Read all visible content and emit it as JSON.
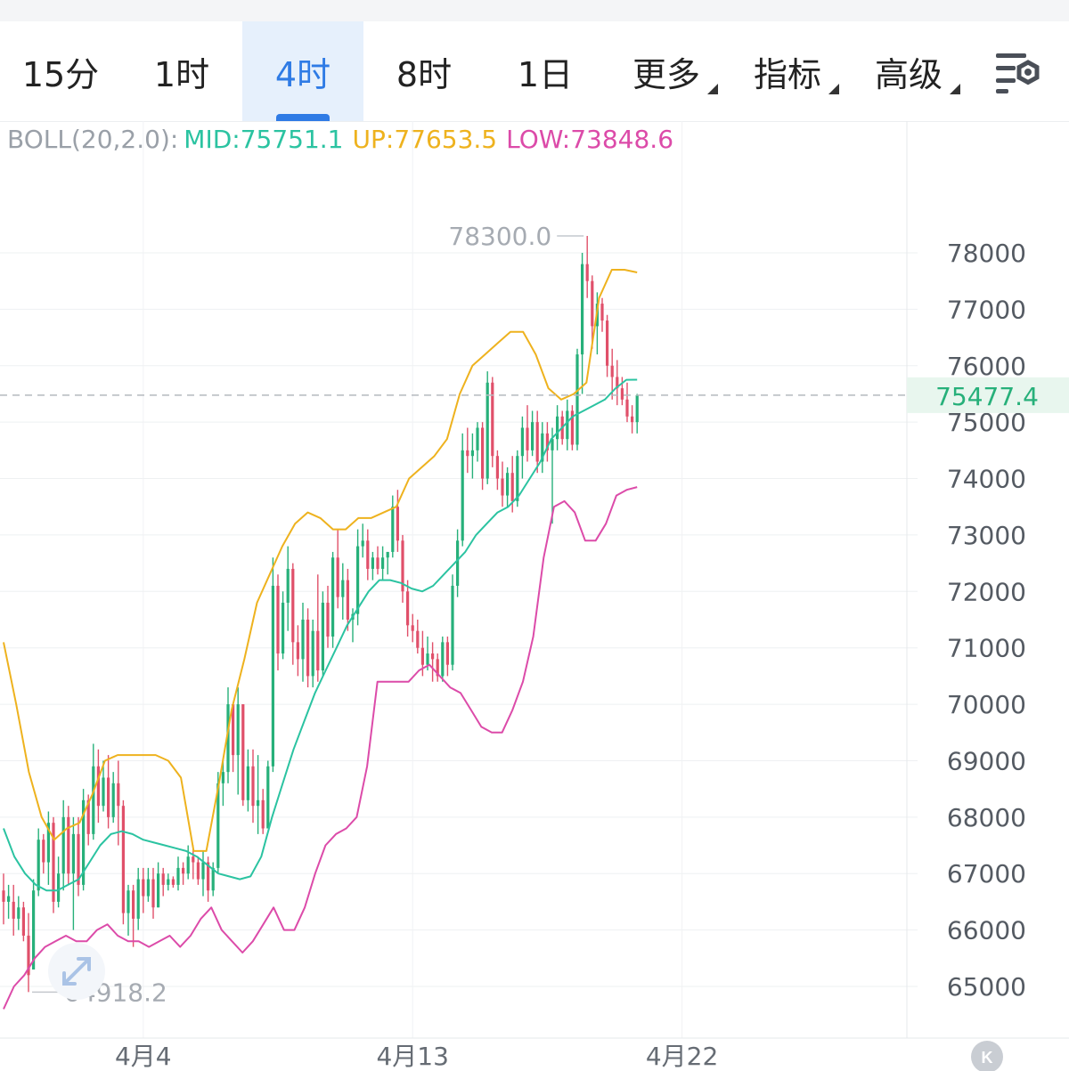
{
  "tabs": [
    {
      "label": "15分",
      "active": false,
      "dropdown": false
    },
    {
      "label": "1时",
      "active": false,
      "dropdown": false
    },
    {
      "label": "4时",
      "active": true,
      "dropdown": false
    },
    {
      "label": "8时",
      "active": false,
      "dropdown": false
    },
    {
      "label": "1日",
      "active": false,
      "dropdown": false
    },
    {
      "label": "更多",
      "active": false,
      "dropdown": true
    },
    {
      "label": "指标",
      "active": false,
      "dropdown": true
    },
    {
      "label": "高级",
      "active": false,
      "dropdown": true
    }
  ],
  "settings_icon": "chart-settings-icon",
  "boll": {
    "name": "BOLL(20,2.0):",
    "mid": "MID:75751.1",
    "up": "UP:77653.5",
    "low": "LOW:73848.6"
  },
  "colors": {
    "up_candle": "#27b07a",
    "down_candle": "#e0506a",
    "mid": "#2bc3a1",
    "upper": "#eeb21e",
    "lower": "#dc4ba9",
    "accent": "#2f7be5",
    "current_price_bg": "#e8f6ee",
    "current_price_text": "#27b07a"
  },
  "chart_data": {
    "type": "candlestick",
    "symbol_timeframe": "4时",
    "y_ticks": [
      65000,
      66000,
      67000,
      68000,
      69000,
      70000,
      71000,
      72000,
      73000,
      74000,
      75000,
      76000,
      77000,
      78000
    ],
    "ylim": [
      64300,
      79000
    ],
    "x_ticks": [
      {
        "index": 28,
        "label": "4月4"
      },
      {
        "index": 82,
        "label": "4月13"
      },
      {
        "index": 136,
        "label": "4月22"
      }
    ],
    "x_count": 152,
    "max_label": "78300.0",
    "min_label": "64918.2",
    "current_price": "75477.4",
    "current_price_value": 75477.4,
    "candles": [
      {
        "o": 66700,
        "h": 67000,
        "l": 66100,
        "c": 66500
      },
      {
        "o": 66500,
        "h": 66800,
        "l": 66200,
        "c": 66600
      },
      {
        "o": 66500,
        "h": 66800,
        "l": 65900,
        "c": 66200
      },
      {
        "o": 66200,
        "h": 66600,
        "l": 66000,
        "c": 66400
      },
      {
        "o": 66400,
        "h": 66500,
        "l": 65800,
        "c": 65900
      },
      {
        "o": 65900,
        "h": 66300,
        "l": 64900,
        "c": 65200
      },
      {
        "o": 65300,
        "h": 66900,
        "l": 65300,
        "c": 66700
      },
      {
        "o": 66700,
        "h": 67800,
        "l": 66600,
        "c": 67600
      },
      {
        "o": 67600,
        "h": 67700,
        "l": 67000,
        "c": 67200
      },
      {
        "o": 67200,
        "h": 68100,
        "l": 66800,
        "c": 67900
      },
      {
        "o": 67900,
        "h": 68000,
        "l": 66300,
        "c": 66500
      },
      {
        "o": 66500,
        "h": 67300,
        "l": 66400,
        "c": 67000
      },
      {
        "o": 67000,
        "h": 68300,
        "l": 66700,
        "c": 68000
      },
      {
        "o": 68000,
        "h": 68200,
        "l": 66800,
        "c": 67000
      },
      {
        "o": 67000,
        "h": 68000,
        "l": 66000,
        "c": 67700
      },
      {
        "o": 67700,
        "h": 68000,
        "l": 66600,
        "c": 66800
      },
      {
        "o": 66800,
        "h": 68500,
        "l": 66700,
        "c": 68300
      },
      {
        "o": 68300,
        "h": 68400,
        "l": 67500,
        "c": 67700
      },
      {
        "o": 67700,
        "h": 69300,
        "l": 67600,
        "c": 68900
      },
      {
        "o": 68900,
        "h": 69200,
        "l": 67900,
        "c": 68200
      },
      {
        "o": 68200,
        "h": 69000,
        "l": 68100,
        "c": 68700
      },
      {
        "o": 68700,
        "h": 69100,
        "l": 67800,
        "c": 68000
      },
      {
        "o": 68000,
        "h": 68800,
        "l": 67900,
        "c": 68600
      },
      {
        "o": 68600,
        "h": 69000,
        "l": 67500,
        "c": 68200
      },
      {
        "o": 68200,
        "h": 68300,
        "l": 66100,
        "c": 66300
      },
      {
        "o": 66300,
        "h": 66800,
        "l": 65900,
        "c": 66700
      },
      {
        "o": 66700,
        "h": 66800,
        "l": 65700,
        "c": 66200
      },
      {
        "o": 66200,
        "h": 67100,
        "l": 66000,
        "c": 66900
      },
      {
        "o": 66900,
        "h": 67100,
        "l": 66300,
        "c": 66600
      },
      {
        "o": 66600,
        "h": 67100,
        "l": 66500,
        "c": 66900
      },
      {
        "o": 66900,
        "h": 67100,
        "l": 66200,
        "c": 66400
      },
      {
        "o": 66400,
        "h": 67200,
        "l": 66400,
        "c": 67000
      },
      {
        "o": 67000,
        "h": 67100,
        "l": 66600,
        "c": 66800
      },
      {
        "o": 66800,
        "h": 67000,
        "l": 66700,
        "c": 66900
      },
      {
        "o": 66900,
        "h": 66950,
        "l": 66750,
        "c": 66800
      },
      {
        "o": 66800,
        "h": 67300,
        "l": 66700,
        "c": 67100
      },
      {
        "o": 67100,
        "h": 67200,
        "l": 66800,
        "c": 67000
      },
      {
        "o": 67000,
        "h": 67500,
        "l": 66900,
        "c": 67300
      },
      {
        "o": 67300,
        "h": 67500,
        "l": 66900,
        "c": 67200
      },
      {
        "o": 67200,
        "h": 67300,
        "l": 66800,
        "c": 66900
      },
      {
        "o": 66900,
        "h": 67400,
        "l": 66600,
        "c": 67200
      },
      {
        "o": 67200,
        "h": 67300,
        "l": 66500,
        "c": 66700
      },
      {
        "o": 66700,
        "h": 67200,
        "l": 66600,
        "c": 67100
      },
      {
        "o": 67100,
        "h": 68800,
        "l": 67000,
        "c": 68600
      },
      {
        "o": 68600,
        "h": 69000,
        "l": 68200,
        "c": 68800
      },
      {
        "o": 68800,
        "h": 70300,
        "l": 68600,
        "c": 70000
      },
      {
        "o": 70000,
        "h": 70000,
        "l": 68800,
        "c": 69100
      },
      {
        "o": 69100,
        "h": 70300,
        "l": 68400,
        "c": 70000
      },
      {
        "o": 70000,
        "h": 70000,
        "l": 68200,
        "c": 68300
      },
      {
        "o": 68300,
        "h": 69200,
        "l": 68100,
        "c": 68900
      },
      {
        "o": 68900,
        "h": 69200,
        "l": 67900,
        "c": 68200
      },
      {
        "o": 68200,
        "h": 69100,
        "l": 67700,
        "c": 68300
      },
      {
        "o": 68300,
        "h": 68500,
        "l": 67700,
        "c": 67800
      },
      {
        "o": 67800,
        "h": 69000,
        "l": 67800,
        "c": 68900
      },
      {
        "o": 68900,
        "h": 72600,
        "l": 68800,
        "c": 72100
      },
      {
        "o": 72100,
        "h": 72300,
        "l": 70600,
        "c": 70900
      },
      {
        "o": 70900,
        "h": 72000,
        "l": 70800,
        "c": 71800
      },
      {
        "o": 71800,
        "h": 72800,
        "l": 71300,
        "c": 72400
      },
      {
        "o": 72400,
        "h": 72500,
        "l": 70700,
        "c": 71100
      },
      {
        "o": 71100,
        "h": 71400,
        "l": 70500,
        "c": 70800
      },
      {
        "o": 70800,
        "h": 71800,
        "l": 70400,
        "c": 71500
      },
      {
        "o": 71500,
        "h": 71700,
        "l": 70300,
        "c": 70500
      },
      {
        "o": 70500,
        "h": 71500,
        "l": 70300,
        "c": 71300
      },
      {
        "o": 71300,
        "h": 72300,
        "l": 70400,
        "c": 70600
      },
      {
        "o": 70600,
        "h": 72000,
        "l": 70500,
        "c": 71800
      },
      {
        "o": 71800,
        "h": 72100,
        "l": 71000,
        "c": 71200
      },
      {
        "o": 71200,
        "h": 72700,
        "l": 71000,
        "c": 72600
      },
      {
        "o": 72600,
        "h": 73100,
        "l": 71700,
        "c": 71900
      },
      {
        "o": 71900,
        "h": 72500,
        "l": 71500,
        "c": 72200
      },
      {
        "o": 72200,
        "h": 72400,
        "l": 71300,
        "c": 71500
      },
      {
        "o": 71500,
        "h": 71700,
        "l": 71100,
        "c": 71600
      },
      {
        "o": 71600,
        "h": 73100,
        "l": 71400,
        "c": 72800
      },
      {
        "o": 72800,
        "h": 73200,
        "l": 72600,
        "c": 72900
      },
      {
        "o": 72900,
        "h": 73100,
        "l": 72200,
        "c": 72400
      },
      {
        "o": 72400,
        "h": 72700,
        "l": 72200,
        "c": 72600
      },
      {
        "o": 72600,
        "h": 72800,
        "l": 72300,
        "c": 72400
      },
      {
        "o": 72400,
        "h": 72800,
        "l": 72200,
        "c": 72600
      },
      {
        "o": 72600,
        "h": 72700,
        "l": 72300,
        "c": 72700
      },
      {
        "o": 72700,
        "h": 73700,
        "l": 72600,
        "c": 73500
      },
      {
        "o": 73500,
        "h": 73800,
        "l": 72700,
        "c": 72900
      },
      {
        "o": 72900,
        "h": 73000,
        "l": 71800,
        "c": 72000
      },
      {
        "o": 72000,
        "h": 72200,
        "l": 71200,
        "c": 71400
      },
      {
        "o": 71400,
        "h": 71600,
        "l": 71100,
        "c": 71300
      },
      {
        "o": 71300,
        "h": 71500,
        "l": 70900,
        "c": 71000
      },
      {
        "o": 71000,
        "h": 71300,
        "l": 70500,
        "c": 70700
      },
      {
        "o": 70700,
        "h": 71200,
        "l": 70600,
        "c": 70900
      },
      {
        "o": 70900,
        "h": 71100,
        "l": 70400,
        "c": 70800
      },
      {
        "o": 70800,
        "h": 70900,
        "l": 70400,
        "c": 70500
      },
      {
        "o": 70500,
        "h": 71200,
        "l": 70400,
        "c": 71100
      },
      {
        "o": 71100,
        "h": 71200,
        "l": 70500,
        "c": 70700
      },
      {
        "o": 70700,
        "h": 72300,
        "l": 70600,
        "c": 72100
      },
      {
        "o": 72100,
        "h": 73100,
        "l": 71900,
        "c": 72900
      },
      {
        "o": 72900,
        "h": 74800,
        "l": 72800,
        "c": 74500
      },
      {
        "o": 74500,
        "h": 74900,
        "l": 74100,
        "c": 74400
      },
      {
        "o": 74400,
        "h": 74800,
        "l": 74000,
        "c": 74500
      },
      {
        "o": 74500,
        "h": 75000,
        "l": 74300,
        "c": 74900
      },
      {
        "o": 74900,
        "h": 75000,
        "l": 73800,
        "c": 74000
      },
      {
        "o": 74000,
        "h": 75900,
        "l": 73900,
        "c": 75700
      },
      {
        "o": 75700,
        "h": 75800,
        "l": 74200,
        "c": 74400
      },
      {
        "o": 74400,
        "h": 74500,
        "l": 73800,
        "c": 74000
      },
      {
        "o": 74000,
        "h": 74300,
        "l": 73500,
        "c": 73700
      },
      {
        "o": 73700,
        "h": 74200,
        "l": 73500,
        "c": 74100
      },
      {
        "o": 74100,
        "h": 74400,
        "l": 73400,
        "c": 73600
      },
      {
        "o": 73600,
        "h": 74500,
        "l": 73500,
        "c": 74400
      },
      {
        "o": 74400,
        "h": 75100,
        "l": 74000,
        "c": 74900
      },
      {
        "o": 74900,
        "h": 75300,
        "l": 74300,
        "c": 74500
      },
      {
        "o": 74500,
        "h": 75200,
        "l": 74400,
        "c": 75000
      },
      {
        "o": 75000,
        "h": 75200,
        "l": 74100,
        "c": 74300
      },
      {
        "o": 74300,
        "h": 75000,
        "l": 74100,
        "c": 74800
      },
      {
        "o": 74800,
        "h": 75000,
        "l": 74300,
        "c": 74500
      },
      {
        "o": 74500,
        "h": 74900,
        "l": 73200,
        "c": 74700
      },
      {
        "o": 74700,
        "h": 75300,
        "l": 74500,
        "c": 75100
      },
      {
        "o": 75100,
        "h": 75200,
        "l": 74600,
        "c": 74700
      },
      {
        "o": 74700,
        "h": 75400,
        "l": 74500,
        "c": 75200
      },
      {
        "o": 75200,
        "h": 75300,
        "l": 74500,
        "c": 74600
      },
      {
        "o": 74600,
        "h": 76300,
        "l": 74500,
        "c": 76200
      },
      {
        "o": 76200,
        "h": 78000,
        "l": 75500,
        "c": 77800
      },
      {
        "o": 77800,
        "h": 78300,
        "l": 77200,
        "c": 77500
      },
      {
        "o": 77500,
        "h": 77600,
        "l": 76300,
        "c": 76700
      },
      {
        "o": 76700,
        "h": 77300,
        "l": 76200,
        "c": 77100
      },
      {
        "o": 77100,
        "h": 77200,
        "l": 76600,
        "c": 76800
      },
      {
        "o": 76800,
        "h": 76900,
        "l": 75800,
        "c": 76000
      },
      {
        "o": 76000,
        "h": 76300,
        "l": 75400,
        "c": 75800
      },
      {
        "o": 75800,
        "h": 76100,
        "l": 75300,
        "c": 75600
      },
      {
        "o": 75600,
        "h": 75800,
        "l": 75300,
        "c": 75400
      },
      {
        "o": 75400,
        "h": 75700,
        "l": 75000,
        "c": 75100
      },
      {
        "o": 75100,
        "h": 75300,
        "l": 74800,
        "c": 75000
      },
      {
        "o": 75000,
        "h": 75500,
        "l": 74800,
        "c": 75477.4
      }
    ],
    "series": [
      {
        "name": "MID",
        "color": "#2bc3a1",
        "values": [
          67800,
          67300,
          67000,
          66800,
          66700,
          66700,
          66800,
          66900,
          67200,
          67500,
          67700,
          67750,
          67700,
          67600,
          67550,
          67500,
          67450,
          67400,
          67300,
          67150,
          67000,
          66950,
          66900,
          66950,
          67300,
          68000,
          68600,
          69200,
          69700,
          70200,
          70600,
          71000,
          71400,
          71700,
          72000,
          72200,
          72200,
          72150,
          72050,
          72000,
          72100,
          72300,
          72500,
          72700,
          73000,
          73200,
          73400,
          73500,
          73700,
          74000,
          74300,
          74700,
          74900,
          75100,
          75200,
          75300,
          75400,
          75600,
          75750,
          75751.1
        ]
      },
      {
        "name": "UP",
        "color": "#eeb21e",
        "values": [
          71100,
          70000,
          68800,
          68000,
          67600,
          67800,
          67900,
          68400,
          69000,
          69100,
          69100,
          69100,
          69100,
          69000,
          68700,
          67400,
          67400,
          68600,
          69900,
          70800,
          71800,
          72300,
          72800,
          73200,
          73400,
          73300,
          73100,
          73100,
          73300,
          73300,
          73400,
          73500,
          74000,
          74200,
          74400,
          74700,
          75500,
          76000,
          76200,
          76400,
          76600,
          76600,
          76200,
          75600,
          75400,
          75500,
          75700,
          77200,
          77700,
          77700,
          77653.5
        ]
      },
      {
        "name": "LOW",
        "color": "#dc4ba9",
        "values": [
          64600,
          65000,
          65200,
          65500,
          65700,
          65800,
          65900,
          65800,
          65800,
          66000,
          66100,
          65900,
          65800,
          65800,
          65700,
          65800,
          65900,
          65700,
          65900,
          66200,
          66400,
          66000,
          65800,
          65600,
          65800,
          66100,
          66400,
          66000,
          66000,
          66400,
          67000,
          67500,
          67700,
          67800,
          68000,
          68900,
          70400,
          70400,
          70400,
          70400,
          70600,
          70700,
          70500,
          70300,
          70200,
          69900,
          69600,
          69500,
          69500,
          69900,
          70400,
          71200,
          72600,
          73500,
          73600,
          73400,
          72900,
          72900,
          73200,
          73700,
          73800,
          73848.6
        ]
      }
    ]
  }
}
